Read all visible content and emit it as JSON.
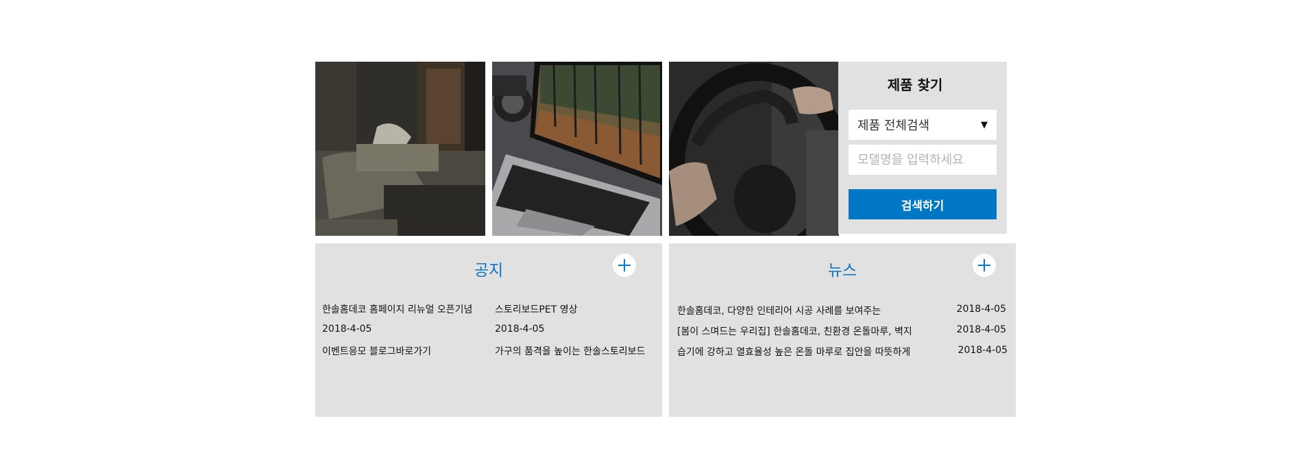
{
  "finder": {
    "title": "제품 찾기",
    "category_selected": "제품 전체검색",
    "category_arrow": "▼",
    "model_placeholder": "모델명을 입력하세요",
    "search_label": "검색하기"
  },
  "notice": {
    "title": "공지",
    "items": [
      {
        "text": "한솔홈데코 홈페이지 리뉴얼 오픈기념"
      },
      {
        "text": "2018-4-05"
      },
      {
        "text": "이벤트응모 블로그바로가기"
      },
      {
        "text": "스토리보드PET 영상"
      },
      {
        "text": "2018-4-05"
      },
      {
        "text": "가구의 품격을 높이는 한솔스토리보드"
      }
    ]
  },
  "news": {
    "title": "뉴스",
    "items": [
      {
        "title": "한솔홈데코, 다양한 인테리어 시공 사례를 보여주는",
        "date": "2018-4-05"
      },
      {
        "title": "[봄이 스며드는 우리집] 한솔홈데코, 친환경 온돌마루, 벽지",
        "date": "2018-4-05"
      },
      {
        "title": "습기에 강하고 열효율성 높은 온돌 마루로 집안을 따뜻하게",
        "date": "2018-4-05"
      }
    ]
  },
  "colors": {
    "accent": "#0077c5",
    "panel_bg": "#e1e1e1"
  },
  "images": [
    "bedroom-photo",
    "laptop-photo",
    "steering-wheel-photo"
  ]
}
